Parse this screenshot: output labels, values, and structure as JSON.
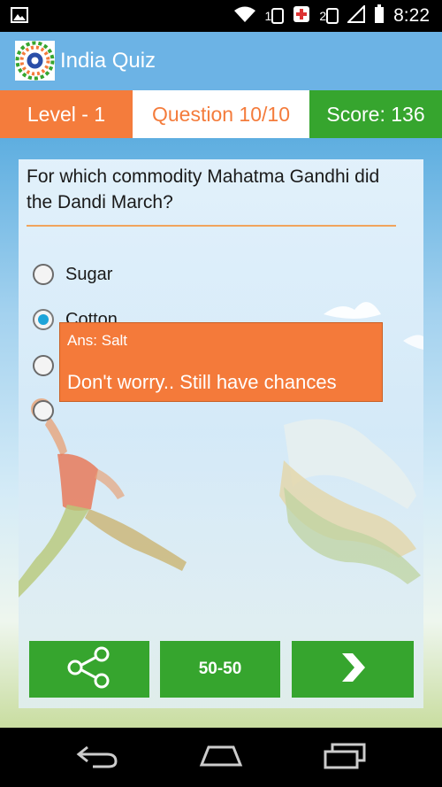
{
  "status_bar": {
    "time": "8:22",
    "sim1": "1",
    "sim2": "2",
    "icons": [
      "image-icon",
      "wifi-icon",
      "sim1-signal-icon",
      "health-icon",
      "sim2-signal-icon",
      "signal-icon",
      "battery-icon"
    ]
  },
  "app_bar": {
    "title": "India Quiz",
    "logo": "india-quiz-logo"
  },
  "info": {
    "level": "Level - 1",
    "question": "Question 10/10",
    "score": "Score: 136"
  },
  "quiz": {
    "question": "For which commodity Mahatma Gandhi did the Dandi March?",
    "options": [
      {
        "label": "Sugar",
        "selected": false
      },
      {
        "label": "Cotton",
        "selected": true
      },
      {
        "label": "",
        "selected": false
      },
      {
        "label": "",
        "selected": false
      }
    ]
  },
  "toast": {
    "title": "Ans: Salt",
    "message": "Don't worry.. Still have chances"
  },
  "buttons": {
    "share_icon": "share-icon",
    "fifty_fifty": "50-50",
    "next_icon": "chevron-right-icon"
  },
  "navigation": {
    "icons": [
      "back-icon",
      "home-icon",
      "recent-apps-icon"
    ]
  },
  "colors": {
    "accent_orange": "#f47c3c",
    "accent_green": "#36a52e",
    "appbar_blue": "#6cb3e5",
    "radio_selected": "#1ea4d9"
  }
}
